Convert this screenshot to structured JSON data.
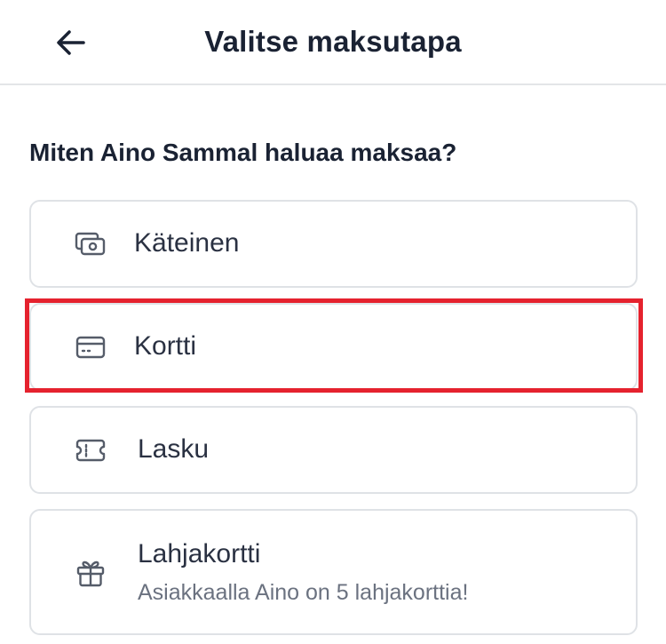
{
  "header": {
    "title": "Valitse maksutapa",
    "back_icon": "arrow-left-icon"
  },
  "question": "Miten Aino Sammal haluaa maksaa?",
  "options": [
    {
      "label": "Käteinen",
      "icon": "cash-icon"
    },
    {
      "label": "Kortti",
      "icon": "credit-card-icon",
      "highlighted": true
    },
    {
      "label": "Lasku",
      "icon": "ticket-icon"
    },
    {
      "label": "Lahjakortti",
      "icon": "gift-icon",
      "sublabel": "Asiakkaalla Aino on 5 lahjakorttia!"
    }
  ],
  "colors": {
    "highlight": "#e5222e",
    "text": "#1a2233",
    "muted": "#6b7280",
    "border": "#dfe2e6"
  }
}
